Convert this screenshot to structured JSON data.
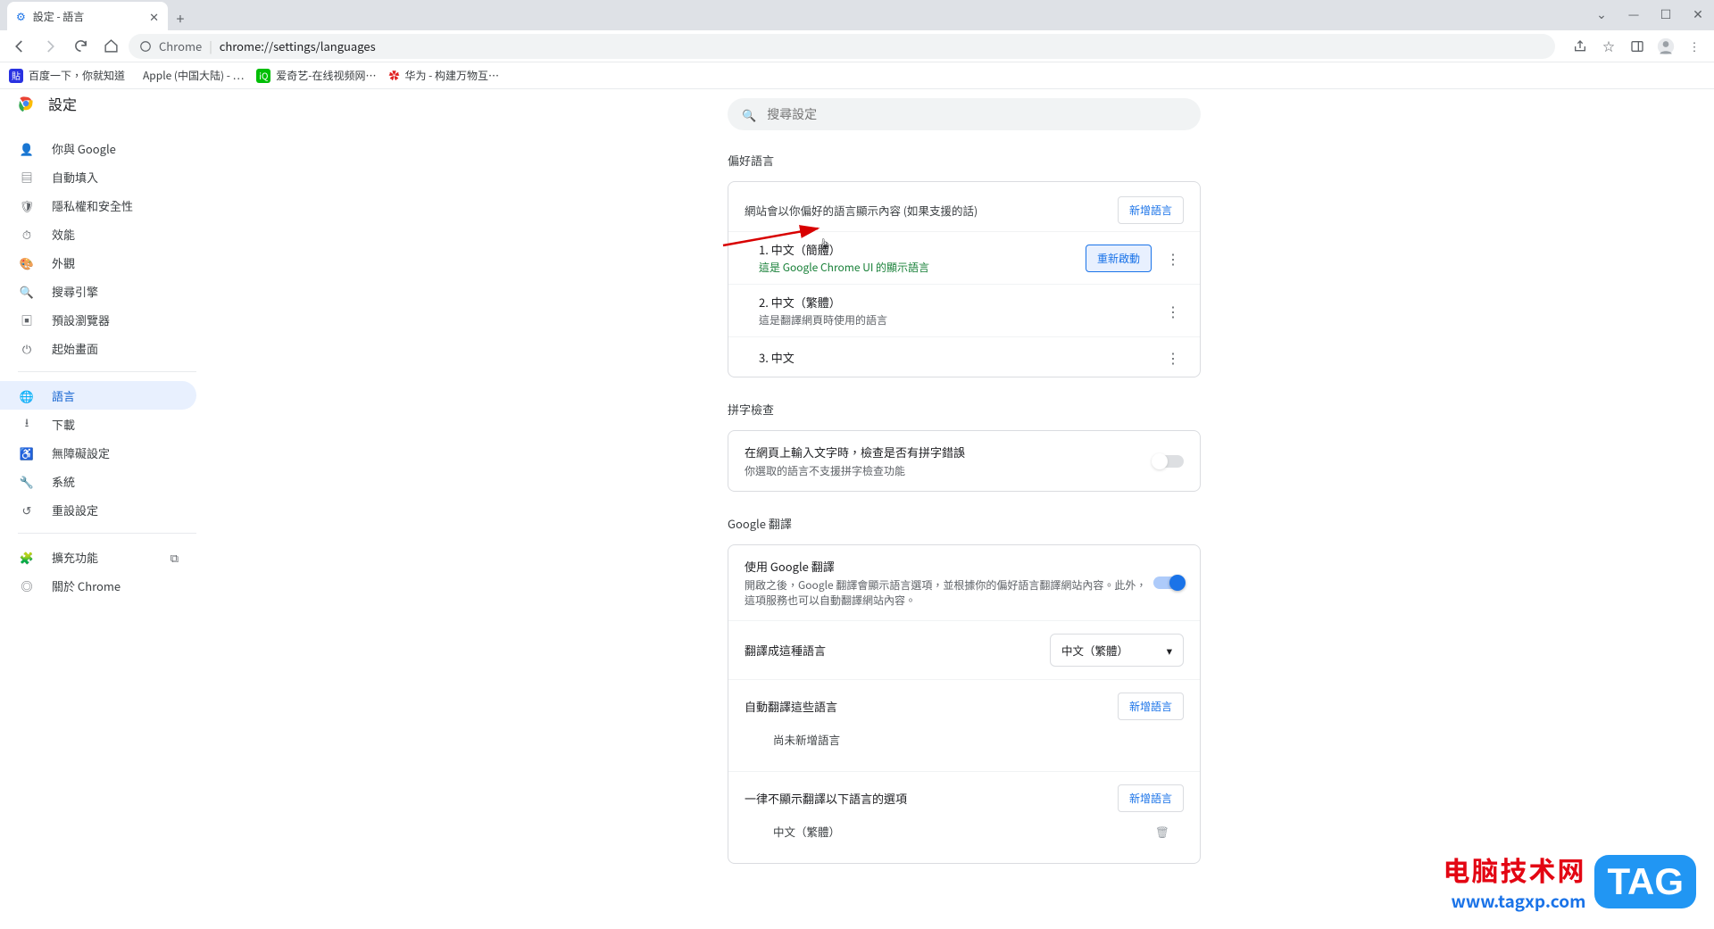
{
  "window": {
    "tab_title": "設定 - 語言",
    "dropdown": "⌄",
    "min": "—",
    "max": "☐",
    "close": "✕"
  },
  "omnibox": {
    "protocol_label": "Chrome",
    "url": "chrome://settings/languages"
  },
  "bookmarks": [
    {
      "label": "百度一下，你就知道"
    },
    {
      "label": "Apple (中国大陆) - …"
    },
    {
      "label": "爱奇艺-在线视频网…"
    },
    {
      "label": "华为 - 构建万物互…"
    }
  ],
  "settings_title": "設定",
  "search_placeholder": "搜尋設定",
  "nav": {
    "you": "你與 Google",
    "autofill": "自動填入",
    "privacy": "隱私權和安全性",
    "performance": "效能",
    "appearance": "外觀",
    "search": "搜尋引擎",
    "default_browser": "預設瀏覽器",
    "startup": "起始畫面",
    "languages": "語言",
    "downloads": "下載",
    "accessibility": "無障礙設定",
    "system": "系統",
    "reset": "重設設定",
    "extensions": "擴充功能",
    "about": "關於 Chrome"
  },
  "preferred": {
    "section": "偏好語言",
    "desc": "網站會以你偏好的語言顯示內容 (如果支援的話)",
    "add_btn": "新增語言",
    "restart_btn": "重新啟動",
    "langs": [
      {
        "name": "1. 中文（簡體）",
        "sub": "這是 Google Chrome UI 的顯示語言",
        "green": true,
        "restart": true
      },
      {
        "name": "2. 中文（繁體）",
        "sub": "這是翻譯網頁時使用的語言",
        "green": false,
        "restart": false
      },
      {
        "name": "3. 中文",
        "sub": "",
        "green": false,
        "restart": false
      }
    ]
  },
  "spell": {
    "section": "拼字檢查",
    "title": "在網頁上輸入文字時，檢查是否有拼字錯誤",
    "sub": "你選取的語言不支援拼字檢查功能"
  },
  "translate": {
    "section": "Google 翻譯",
    "use_title": "使用 Google 翻譯",
    "use_sub": "開啟之後，Google 翻譯會顯示語言選項，並根據你的偏好語言翻譯網站內容。此外，這項服務也可以自動翻譯網站內容。",
    "target_label": "翻譯成這種語言",
    "target_value": "中文（繁體）",
    "auto_label": "自動翻譯這些語言",
    "add_btn": "新增語言",
    "none_added": "尚未新增語言",
    "never_label": "一律不顯示翻譯以下語言的選項",
    "never_lang": "中文（繁體）"
  },
  "watermark": {
    "cn": "电脑技术网",
    "url": "www.tagxp.com",
    "tag": "TAG"
  }
}
